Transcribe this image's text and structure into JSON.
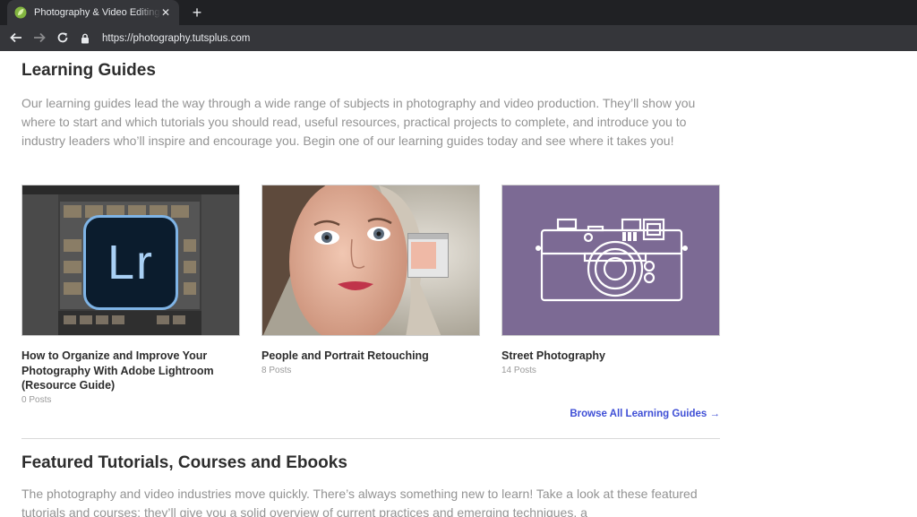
{
  "browser": {
    "tab_title": "Photography & Video Editing How-To Tutorials by Envato Tuts+",
    "url": "https://photography.tutsplus.com"
  },
  "section_guides": {
    "heading": "Learning Guides",
    "description": "Our learning guides lead the way through a wide range of subjects in photography and video production. They’ll show you where to start and which tutorials you should read, useful resources, practical projects to complete, and introduce you to industry leaders who’ll inspire and encourage you. Begin one of our learning guides today and see where it takes you!",
    "cards": [
      {
        "title": "How to Organize and Improve Your Photography With Adobe Lightroom (Resource Guide)",
        "meta": "0 Posts",
        "thumb_label": "Lr"
      },
      {
        "title": "People and Portrait Retouching",
        "meta": "8 Posts"
      },
      {
        "title": "Street Photography",
        "meta": "14 Posts"
      }
    ],
    "browse_link": "Browse All Learning Guides →"
  },
  "section_featured": {
    "heading": "Featured Tutorials, Courses and Ebooks",
    "description": "The photography and video industries move quickly. There’s always something new to learn! Take a look at these featured tutorials and courses; they’ll give you a solid overview of current practices and emerging techniques, a"
  },
  "colors": {
    "link": "#3f4fd6",
    "street_thumb_bg": "#7c6a94",
    "lightroom_blue": "#31a8ff"
  }
}
